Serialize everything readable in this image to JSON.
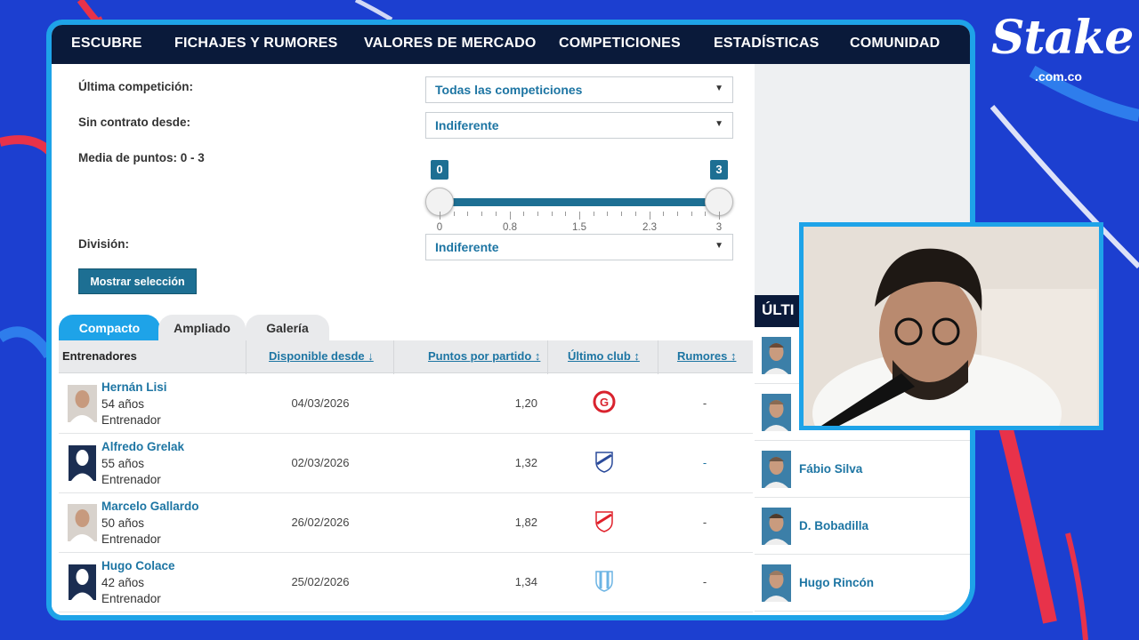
{
  "brand": {
    "logo_text": "Stake",
    "logo_sub": ".com.co",
    "accent": "#1ea3e8",
    "bg": "#1c3fd0"
  },
  "nav": {
    "items": [
      "ESCUBRE",
      "FICHAJES Y RUMORES",
      "VALORES DE MERCADO",
      "COMPETICIONES",
      "ESTADÍSTICAS",
      "COMUNIDAD"
    ]
  },
  "filters": {
    "last_competition": {
      "label": "Última competición:",
      "value": "Todas las competiciones"
    },
    "no_contract": {
      "label": "Sin contrato desde:",
      "value": "Indiferente"
    },
    "points_avg": {
      "label": "Media de puntos:  0 - 3",
      "min": "0",
      "max": "3",
      "ticks": [
        "0",
        "0.8",
        "1.5",
        "2.3",
        "3"
      ],
      "range_fraction": [
        0,
        1
      ]
    },
    "division": {
      "label": "División:",
      "value": "Indiferente"
    },
    "show_button": "Mostrar selección"
  },
  "tabs": [
    "Compacto",
    "Ampliado",
    "Galería"
  ],
  "table": {
    "headers": {
      "coaches": "Entrenadores",
      "available": "Disponible desde ↓",
      "points": "Puntos por partido ↕",
      "last_club": "Último club ↕",
      "rumors": "Rumores ↕"
    },
    "rows": [
      {
        "name": "Hernán Lisi",
        "age": "54 años",
        "role": "Entrenador",
        "date": "04/03/2026",
        "ppm": "1,20",
        "rumors": "-",
        "club_icon": "deportivo-club-crest",
        "club_color": "#d9232e"
      },
      {
        "name": "Alfredo Grelak",
        "age": "55 años",
        "role": "Entrenador",
        "date": "02/03/2026",
        "ppm": "1,32",
        "rumors": "-",
        "club_icon": "shield-crest",
        "club_color": "#2a4a9a"
      },
      {
        "name": "Marcelo Gallardo",
        "age": "50 años",
        "role": "Entrenador",
        "date": "26/02/2026",
        "ppm": "1,82",
        "rumors": "-",
        "club_icon": "river-plate-crest",
        "club_color": "#e0202a"
      },
      {
        "name": "Hugo Colace",
        "age": "42 años",
        "role": "Entrenador",
        "date": "25/02/2026",
        "ppm": "1,34",
        "rumors": "-",
        "club_icon": "striped-crest",
        "club_color": "#6cb4e4"
      }
    ]
  },
  "sidebar": {
    "header": "ÚLTI",
    "items": [
      {
        "name": ""
      },
      {
        "name": ""
      },
      {
        "name": "Fábio Silva"
      },
      {
        "name": "D. Bobadilla"
      },
      {
        "name": "Hugo Rincón"
      }
    ]
  },
  "webcam": {
    "label": "streamer-webcam"
  }
}
